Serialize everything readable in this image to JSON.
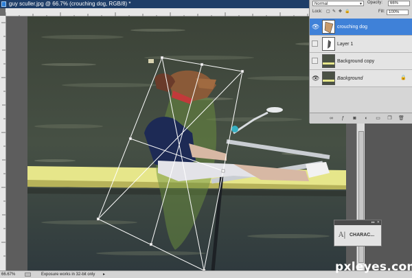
{
  "window": {
    "title": "guy sculler.jpg @ 66.7% (crouching dog, RGB/8) *"
  },
  "layers_panel": {
    "blend_mode": "Normal",
    "opacity_label": "Opacity:",
    "opacity_value": "66%",
    "lock_label": "Lock:",
    "fill_label": "Fill:",
    "fill_value": "100%",
    "layers": [
      {
        "name": "crouching dog",
        "visible": true,
        "selected": true,
        "italic": false,
        "locked": false
      },
      {
        "name": "Layer 1",
        "visible": false,
        "selected": false,
        "italic": false,
        "locked": false
      },
      {
        "name": "Background copy",
        "visible": false,
        "selected": false,
        "italic": false,
        "locked": false
      },
      {
        "name": "Background",
        "visible": true,
        "selected": false,
        "italic": true,
        "locked": true
      }
    ],
    "footer_icons": [
      "link-icon",
      "fx-icon",
      "mask-icon",
      "adjustment-icon",
      "group-icon",
      "new-layer-icon",
      "trash-icon"
    ]
  },
  "character_panel": {
    "label": "CHARAC..."
  },
  "statusbar": {
    "zoom": "66.67%",
    "info": "Exposure works in 32-bit only"
  },
  "watermark": "pxleyes.com",
  "colors": {
    "title_bar": "#1f3e68",
    "selected_layer": "#3f81d8",
    "boat_yellow": "#e6e68a",
    "water": "#3f463f"
  }
}
